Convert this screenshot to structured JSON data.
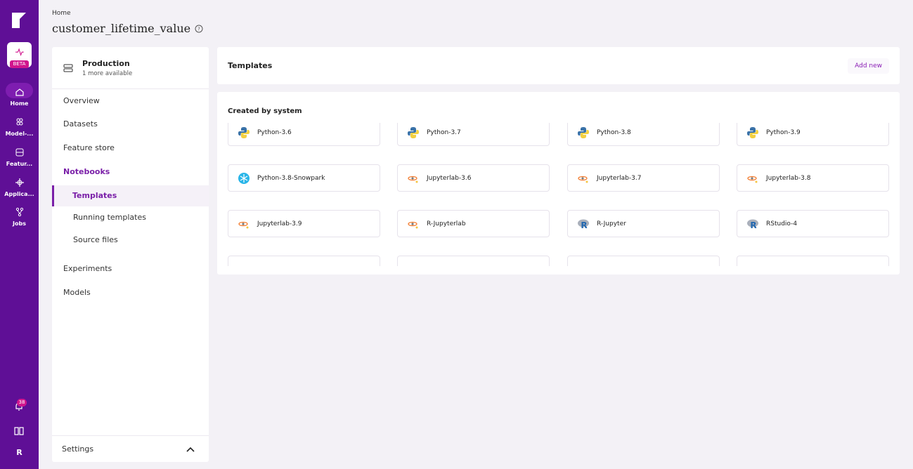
{
  "rail": {
    "beta": "BETA",
    "items": [
      {
        "label": "Home",
        "icon": "home-icon"
      },
      {
        "label": "Model-...",
        "icon": "model-icon"
      },
      {
        "label": "Featur...",
        "icon": "feature-icon"
      },
      {
        "label": "Applica...",
        "icon": "application-icon"
      },
      {
        "label": "Jobs",
        "icon": "jobs-icon"
      }
    ],
    "notifications": "38",
    "user_initial": "R"
  },
  "header": {
    "breadcrumb": "Home",
    "title": "customer_lifetime_value"
  },
  "sidebar": {
    "env_title": "Production",
    "env_sub": "1 more available",
    "nav": [
      "Overview",
      "Datasets",
      "Feature store",
      "Notebooks",
      "Templates",
      "Running templates",
      "Source files",
      "Experiments",
      "Models"
    ],
    "settings": "Settings"
  },
  "templates": {
    "title": "Templates",
    "add_new": "Add new",
    "section": "Created by system",
    "items": [
      {
        "label": "Python-3.6",
        "icon": "python-icon"
      },
      {
        "label": "Python-3.7",
        "icon": "python-icon"
      },
      {
        "label": "Python-3.8",
        "icon": "python-icon"
      },
      {
        "label": "Python-3.9",
        "icon": "python-icon"
      },
      {
        "label": "Python-3.8-Snowpark",
        "icon": "snowflake-icon"
      },
      {
        "label": "Jupyterlab-3.6",
        "icon": "jupyter-icon"
      },
      {
        "label": "Jupyterlab-3.7",
        "icon": "jupyter-icon"
      },
      {
        "label": "Jupyterlab-3.8",
        "icon": "jupyter-icon"
      },
      {
        "label": "Jupyterlab-3.9",
        "icon": "jupyter-icon"
      },
      {
        "label": "R-Jupyterlab",
        "icon": "jupyter-icon"
      },
      {
        "label": "R-Jupyter",
        "icon": "r-icon"
      },
      {
        "label": "RStudio-4",
        "icon": "r-icon"
      }
    ]
  },
  "colors": {
    "brand": "#5f0f96",
    "accent": "#7a1fa8",
    "badge": "#d1158d"
  }
}
